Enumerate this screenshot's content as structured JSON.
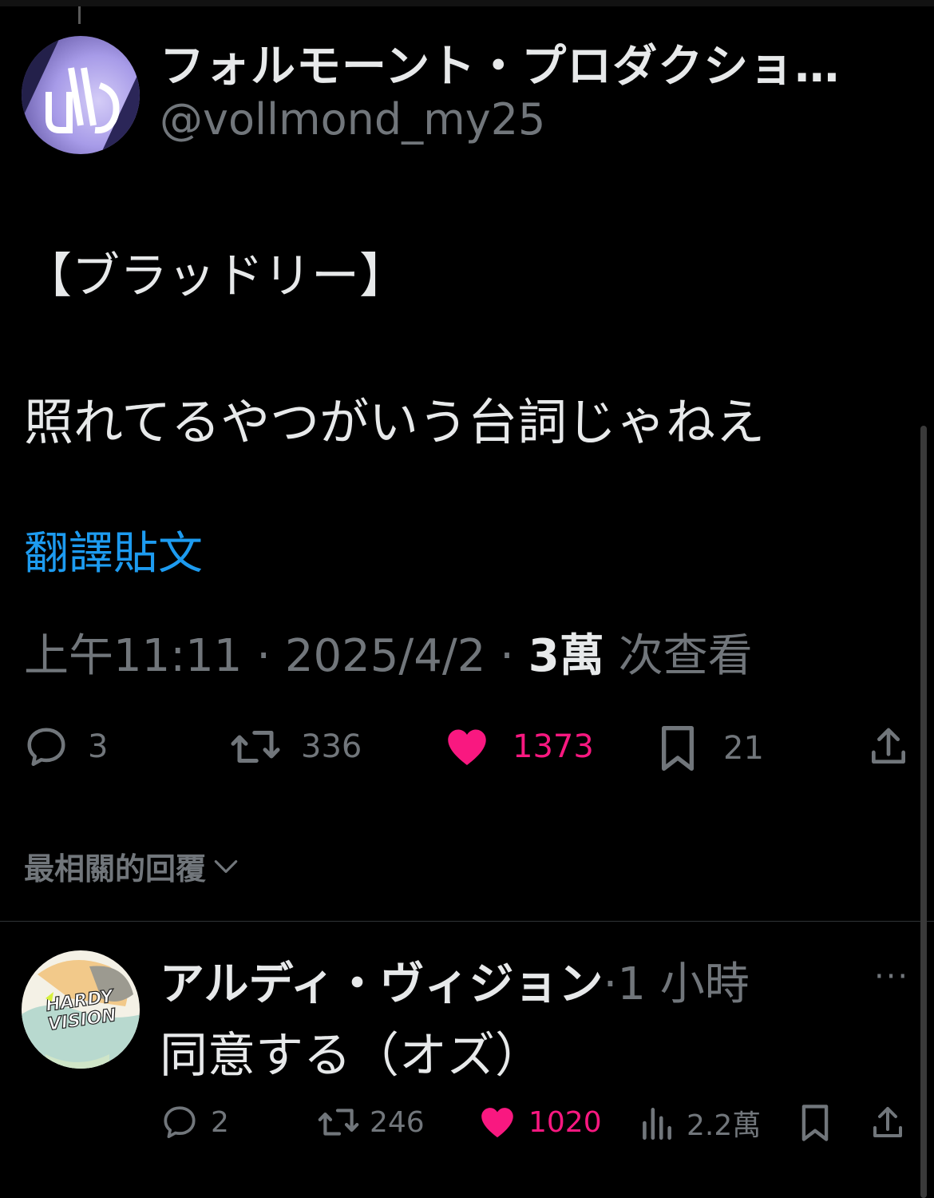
{
  "tweet": {
    "author_name": "フォルモーント・プロダクショ…",
    "author_handle": "@vollmond_my25",
    "text_line1": "【ブラッドリー】",
    "text_line2": "照れてるやつがいう台詞じゃねえ",
    "translate_label": "翻譯貼文",
    "time": "上午11:11",
    "date": "2025/4/2",
    "views_count": "3萬",
    "views_label": "次查看",
    "separator": "·",
    "replies": "3",
    "reposts": "336",
    "likes": "1373",
    "bookmarks": "21",
    "icons": [
      "reply-icon",
      "repost-icon",
      "like-icon-filled",
      "bookmark-icon",
      "share-icon"
    ]
  },
  "replies_sort": {
    "label": "最相關的回覆",
    "icon": "chevron-down-icon"
  },
  "reply": {
    "author_name": "アルディ・ヴィジョン",
    "separator": "·",
    "time_ago": "1 小時",
    "more_label": "···",
    "text": "同意する（オズ）",
    "avatar_text": "HARDY VISION",
    "replies": "2",
    "reposts": "246",
    "likes": "1020",
    "views": "2.2萬",
    "icons": [
      "reply-icon",
      "repost-icon",
      "like-icon-filled",
      "views-icon",
      "bookmark-icon",
      "share-icon"
    ]
  },
  "colors": {
    "background": "#000000",
    "primary_text": "#e7e9ea",
    "secondary_text": "#71767b",
    "link": "#1d9bf0",
    "like": "#f91880"
  }
}
